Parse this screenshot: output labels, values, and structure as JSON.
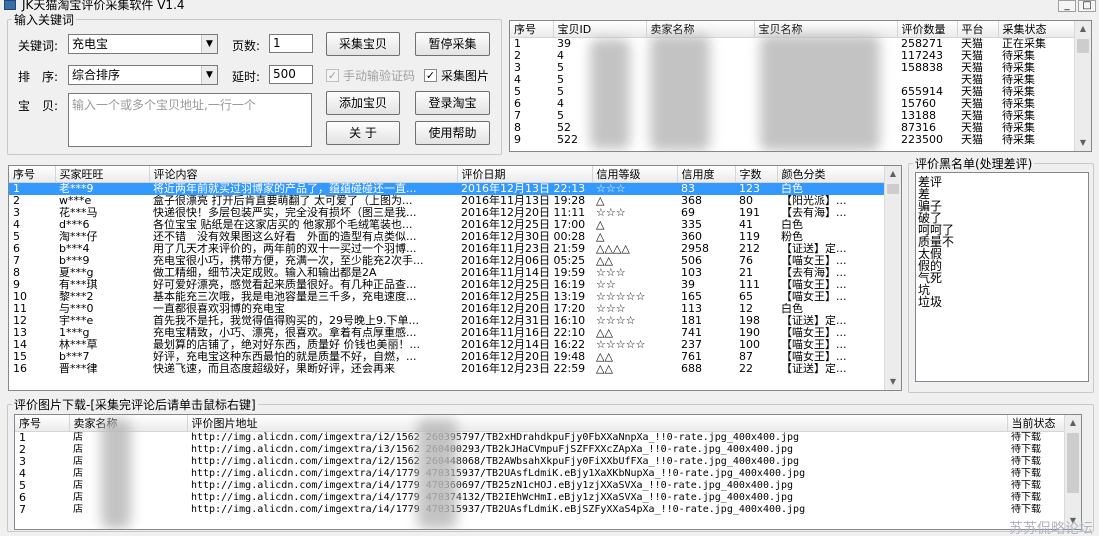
{
  "window": {
    "title": "JK天猫淘宝评价采集软件 V1.4",
    "minimize": "_",
    "maximize": "□"
  },
  "keyword_group": {
    "legend": "输入关键词",
    "keyword_label": "关键词:",
    "keyword_value": "充电宝",
    "pages_label": "页数:",
    "pages_value": "1",
    "sort_label": "排　序:",
    "sort_value": "综合排序",
    "delay_label": "延时:",
    "delay_value": "500",
    "item_label": "宝　贝:",
    "item_placeholder": "输入一个或多个宝贝地址,一行一个",
    "manual_captcha_label": "手动输验证码",
    "collect_images_label": "采集图片",
    "buttons": {
      "collect_items": "采集宝贝",
      "pause": "暂停采集",
      "add_item": "添加宝贝",
      "login": "登录淘宝",
      "about": "关 于",
      "help": "使用帮助"
    }
  },
  "items_table": {
    "columns": [
      "序号",
      "宝贝ID",
      "卖家名称",
      "宝贝名称",
      "评价数量",
      "平台",
      "采集状态"
    ],
    "rows": [
      [
        "1",
        "39",
        "",
        "",
        "258271",
        "天猫",
        "正在采集"
      ],
      [
        "2",
        "4",
        "",
        "",
        "117243",
        "天猫",
        "待采集"
      ],
      [
        "3",
        "5",
        "",
        "",
        "158838",
        "天猫",
        "待采集"
      ],
      [
        "4",
        "5",
        "",
        "",
        "",
        "天猫",
        "待采集"
      ],
      [
        "5",
        "5",
        "",
        "",
        "655914",
        "天猫",
        "待采集"
      ],
      [
        "6",
        "4",
        "",
        "",
        "15760",
        "天猫",
        "待采集"
      ],
      [
        "7",
        "5",
        "",
        "",
        "13188",
        "天猫",
        "待采集"
      ],
      [
        "8",
        "52",
        "",
        "",
        "87316",
        "天猫",
        "待采集"
      ],
      [
        "9",
        "522",
        "",
        "",
        "223500",
        "天猫",
        "待采集"
      ]
    ]
  },
  "reviews_table": {
    "columns": [
      "序号",
      "买家旺旺",
      "评论内容",
      "评价日期",
      "信用等级",
      "信用度",
      "字数",
      "颜色分类"
    ],
    "rows": [
      [
        "1",
        "老***9",
        "将近两年前就买过羽博家的产品了，蕴蕴碰碰还一直...",
        "2016年12月13日  22:13",
        "☆☆☆",
        "83",
        "123",
        "白色"
      ],
      [
        "2",
        "w***e",
        "盒子很漂亮 打开后肯直要萌翻了 太可爱了（上图为...",
        "2016年11月13日  19:28",
        "△",
        "368",
        "80",
        "【阳光派】..."
      ],
      [
        "3",
        "花***马",
        "快递很快！多层包装严实，完全没有损坏（图三是我...",
        "2016年12月20日  11:11",
        "☆☆☆",
        "69",
        "191",
        "【去有海】..."
      ],
      [
        "4",
        "d***6",
        "各位宝宝 贴纸是在这家店买的 他家那个毛绒笔装也...",
        "2016年12月25日  17:00",
        "△",
        "335",
        "41",
        "白色"
      ],
      [
        "5",
        "淘***仔",
        "还不错　没有效果图这么好看　外面的造型有点类似...",
        "2016年12月30日  00:28",
        "△",
        "360",
        "119",
        "粉色"
      ],
      [
        "6",
        "b***4",
        "用了几天才来评价的，两年前的双十一买过一个羽博...",
        "2016年11月23日  21:59",
        "△△△△",
        "2958",
        "212",
        "【证送】定..."
      ],
      [
        "7",
        "b***9",
        "充电宝很小巧，携带方便，充满一次，至少能充2次手...",
        "2016年12月06日  05:25",
        "△△",
        "506",
        "76",
        "【喵女王】..."
      ],
      [
        "8",
        "夏***g",
        "做工精细，细节决定成败。输入和输出都是2A",
        "2016年11月14日  19:59",
        "☆☆☆",
        "103",
        "21",
        "【去有海】..."
      ],
      [
        "9",
        "有***琪",
        "好可爱好漂亮，感觉看起来质量很好。有几种正品查...",
        "2016年12月25日  16:19",
        "☆☆",
        "39",
        "111",
        "【喵女王】..."
      ],
      [
        "10",
        "黎***2",
        "基本能充三次哦，我是电池容量是三千多，充电速度...",
        "2016年12月25日  13:19",
        "☆☆☆☆☆",
        "165",
        "65",
        "【喵女王】..."
      ],
      [
        "11",
        "与***0",
        "一直都很喜欢羽博的充电宝",
        "2016年12月20日  17:20",
        "☆☆☆",
        "113",
        "12",
        "白色"
      ],
      [
        "12",
        "宇***e",
        "首先我不是托，我觉得值得购买的，29号晚上9.下单...",
        "2016年12月31日  16:10",
        "☆☆☆☆",
        "181",
        "198",
        "【证送】定..."
      ],
      [
        "13",
        "1***g",
        "充电宝精致，小巧、漂亮，很喜欢。拿着有点厚重感...",
        "2016年11月16日  22:10",
        "△△",
        "741",
        "190",
        "【喵女王】..."
      ],
      [
        "14",
        "林***草",
        "最划算的店铺了，绝对好东西，质量好 价钱也美丽！...",
        "2016年12月14日  16:22",
        "☆☆☆☆☆",
        "237",
        "100",
        "【喵女王】..."
      ],
      [
        "15",
        "b***7",
        "好评，充电宝这种东西最怕的就是质量不好，自燃，...",
        "2016年12月20日  19:48",
        "△△",
        "761",
        "87",
        "【喵女王】..."
      ],
      [
        "16",
        "晋***律",
        "快递飞速，而且态度超级好，果断好评，还会再来",
        "2016年12月23日  22:59",
        "△△",
        "688",
        "22",
        "【证送】定..."
      ]
    ]
  },
  "blacklist": {
    "legend": "评价黑名单(处理差评)",
    "words": [
      "差评",
      "差",
      "骗子",
      "破了",
      "呵呵了",
      "质量不",
      "太假",
      "假的",
      "气死",
      "坑",
      "垃圾"
    ]
  },
  "image_download": {
    "legend": "评价图片下载-[采集完评论后请单击鼠标右键]",
    "columns": [
      "序号",
      "卖家名称",
      "评价图片地址",
      "当前状态"
    ],
    "rows": [
      [
        "1",
        "店",
        "http://img.alicdn.com/imgextra/i2/1562 260395797/TB2xHDrahdkpuFjy0FbXXaNnpXa_!!0-rate.jpg_400x400.jpg",
        "待下载"
      ],
      [
        "2",
        "店",
        "http://img.alicdn.com/imgextra/i3/1562 260400293/TB2kJHaCVmpuFjSZFFXXcZApXa_!!0-rate.jpg_400x400.jpg",
        "待下载"
      ],
      [
        "3",
        "店",
        "http://img.alicdn.com/imgextra/i2/1562 260448068/TB2AWbsahXkpuFjy0FiXXbUfFXa_!!0-rate.jpg_400x400.jpg",
        "待下载"
      ],
      [
        "4",
        "店",
        "http://img.alicdn.com/imgextra/i4/1779 470315937/TB2UAsfLdmiK.eBjy1XaXKbNupXa_!!0-rate.jpg_400x400.jpg",
        "待下载"
      ],
      [
        "5",
        "店",
        "http://img.alicdn.com/imgextra/i4/1779 470360697/TB25zN1cHOJ.eBjy1zjXXaSVXa_!!0-rate.jpg_400x400.jpg",
        "待下载"
      ],
      [
        "6",
        "店",
        "http://img.alicdn.com/imgextra/i4/1779 470374132/TB2IEhWcHmI.eBjy1zjXXaSVXa_!!0-rate.jpg_400x400.jpg",
        "待下载"
      ],
      [
        "7",
        "店",
        "http://img.alicdn.com/imgextra/i4/1779 470315937/TB2UAsfLdmiK.eBjSZFyXXaS4pXa_!!0-rate.jpg_400x400.jpg",
        "待下载"
      ]
    ]
  },
  "watermark": "苏苏侃略论坛",
  "colors": {
    "selection": "#3399ff",
    "window_bg": "#f0f0f0"
  }
}
